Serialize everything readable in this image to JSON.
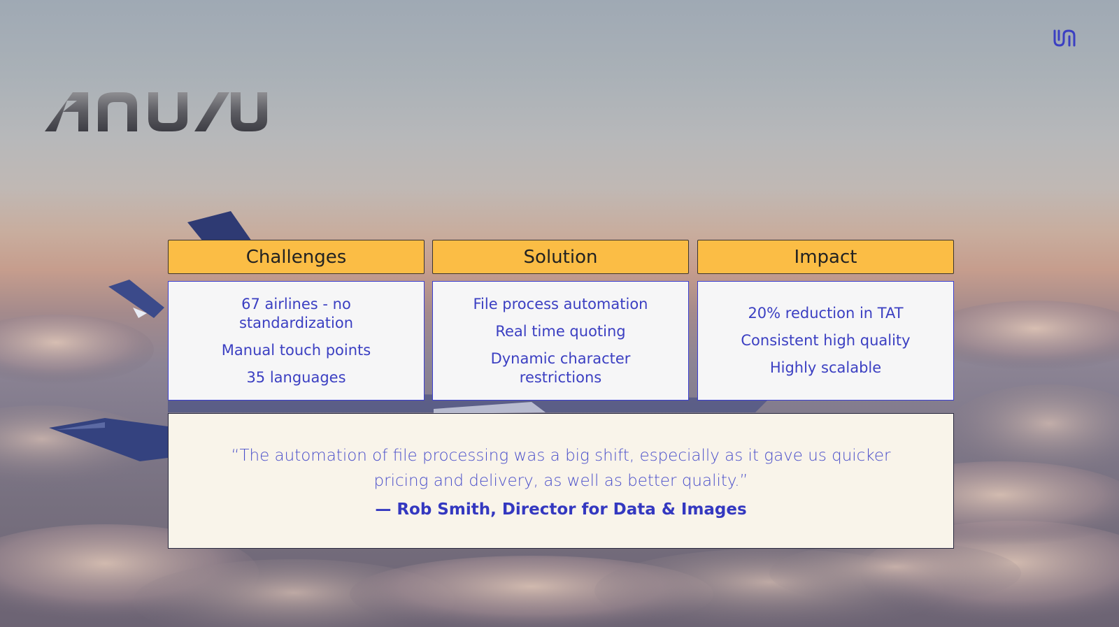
{
  "brand": {
    "logo_text": "ANUVU",
    "corner_icon": "anuvu-mark-icon"
  },
  "columns": [
    {
      "header": "Challenges",
      "items": [
        "67 airlines - no standardization",
        "Manual touch points",
        "35 languages"
      ]
    },
    {
      "header": "Solution",
      "items": [
        "File process automation",
        "Real time quoting",
        "Dynamic character restrictions"
      ]
    },
    {
      "header": "Impact",
      "items": [
        "20% reduction in TAT",
        "Consistent high quality",
        "Highly scalable"
      ]
    }
  ],
  "testimonial": {
    "quote": "“The automation of file processing was a big shift, especially as it gave us quicker pricing and delivery, as well as better quality.”",
    "author": "— Rob Smith, Director for Data & Images"
  },
  "colors": {
    "header_fill": "#fbbd45",
    "accent_blue": "#3b3fc2",
    "quote_bg": "#f9f4ea"
  }
}
